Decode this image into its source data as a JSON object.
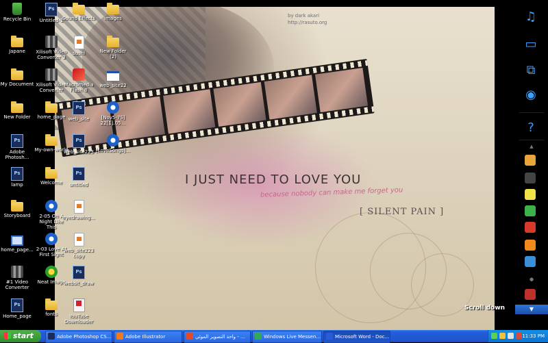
{
  "wallpaper": {
    "credit_line1": "by dark akari",
    "credit_line2": "http://rasuto.org",
    "title": "I JUST NEED TO LOVE YOU",
    "subtitle": "because nobody can make me forget you",
    "tag": "[ SILENT PAIN ]"
  },
  "icons": [
    {
      "label": "Recycle Bin",
      "icon": "recycle-bin-icon"
    },
    {
      "label": "Untitled-1",
      "icon": "photoshop-file-icon"
    },
    {
      "label": "Sound Effects",
      "icon": "folder-icon"
    },
    {
      "label": "images",
      "icon": "folder-icon"
    },
    {
      "label": "Japane",
      "icon": "folder-icon"
    },
    {
      "label": "Xilisoft Video Converter 3",
      "icon": "video-converter-icon"
    },
    {
      "label": "sushi",
      "icon": "document-icon"
    },
    {
      "label": "New Folder (2)",
      "icon": "folder-icon"
    },
    {
      "label": "My Document",
      "icon": "my-documents-icon"
    },
    {
      "label": "Xilisoft Video Converter",
      "icon": "video-converter-icon"
    },
    {
      "label": "Macromedia Flash 8",
      "icon": "flash-icon"
    },
    {
      "label": "web_site22",
      "icon": "window-icon"
    },
    {
      "label": "New Folder",
      "icon": "folder-icon"
    },
    {
      "label": "home_page",
      "icon": "folder-icon"
    },
    {
      "label": "web_site",
      "icon": "photoshop-file-icon"
    },
    {
      "label": "[Nov5-7S] 22[1].05...",
      "icon": "media-icon"
    },
    {
      "label": "Adobe Photosh...",
      "icon": "photoshop-icon"
    },
    {
      "label": "My-own-world",
      "icon": "folder-icon"
    },
    {
      "label": "web_site223",
      "icon": "photoshop-file-icon"
    },
    {
      "label": "[LoveSongs]...",
      "icon": "media-icon"
    },
    {
      "label": "lamp",
      "icon": "photoshop-file-icon"
    },
    {
      "label": "Welcome",
      "icon": "folder-icon"
    },
    {
      "label": "untitled",
      "icon": "photoshop-file-icon"
    },
    {
      "label": "Storyboard",
      "icon": "folder-icon"
    },
    {
      "label": "2-05 On A Night Like This",
      "icon": "media-icon"
    },
    {
      "label": "eyedrawing...",
      "icon": "document-icon"
    },
    {
      "label": "home_page...",
      "icon": "my-computer-icon"
    },
    {
      "label": "2-03 Love At First Sight",
      "icon": "media-icon"
    },
    {
      "label": "web_site223 copy",
      "icon": "document-icon"
    },
    {
      "label": "#1 Video Converter",
      "icon": "video-converter-icon"
    },
    {
      "label": "Neat Image",
      "icon": "flower-icon"
    },
    {
      "label": "websit_draw",
      "icon": "photoshop-file-icon"
    },
    {
      "label": "Home_page",
      "icon": "photoshop-file-icon"
    },
    {
      "label": "fonts",
      "icon": "folder-icon"
    },
    {
      "label": "YouTube Downloader",
      "icon": "downloader-icon"
    }
  ],
  "sidebar": {
    "scroll_label": "Scroll down",
    "colors": {
      "accent": "#3aa0ff"
    }
  },
  "taskbar": {
    "start_label": "start",
    "tasks": [
      {
        "label": "Adobe Photoshop CS...",
        "icon": "photoshop-icon",
        "active": false
      },
      {
        "label": "Adobe Illustrator",
        "icon": "illustrator-icon",
        "active": false
      },
      {
        "label": "واحة التصوير الموئي - ...",
        "icon": "browser-icon",
        "active": false
      },
      {
        "label": "Windows Live Messen...",
        "icon": "messenger-icon",
        "active": false
      },
      {
        "label": "Microsoft Word - Doc...",
        "icon": "word-icon",
        "active": true
      }
    ],
    "clock": "11:33 PM"
  }
}
